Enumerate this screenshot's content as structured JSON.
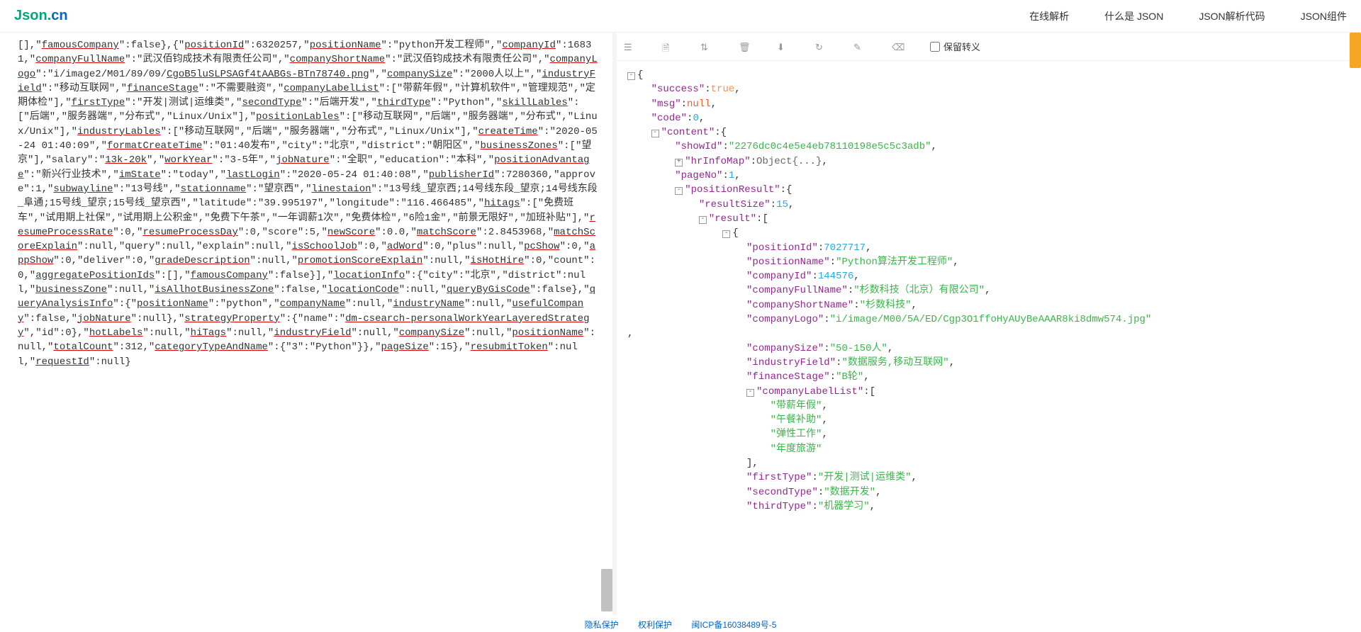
{
  "header": {
    "logo_json": "Json",
    "logo_dot": ".",
    "logo_cn": "cn",
    "nav": [
      "在线解析",
      "什么是 JSON",
      "JSON解析代码",
      "JSON组件"
    ]
  },
  "toolbar": {
    "keep_escape_label": "保留转义"
  },
  "left_raw": {
    "segments": [
      {
        "t": "[],\""
      },
      {
        "t": "famousCompany",
        "u": 1
      },
      {
        "t": "\":false},{\""
      },
      {
        "t": "positionId",
        "u": 1
      },
      {
        "t": "\":6320257,\""
      },
      {
        "t": "positionName",
        "u": 1
      },
      {
        "t": "\":\"python开发工程师\",\""
      },
      {
        "t": "companyId",
        "u": 1
      },
      {
        "t": "\":16831,\""
      },
      {
        "t": "companyFullName",
        "u": 1
      },
      {
        "t": "\":\"武汉佰钧成技术有限责任公司\",\""
      },
      {
        "t": "companyShortName",
        "u": 1
      },
      {
        "t": "\":\"武汉佰钧成技术有限责任公司\",\""
      },
      {
        "t": "companyLogo",
        "u": 1
      },
      {
        "t": "\":\"i/image2/M01/89/09/"
      },
      {
        "t": "CgoB5luSLPSAGf4tAABGs-BTn78740.png",
        "u": 1
      },
      {
        "t": "\",\""
      },
      {
        "t": "companySize",
        "u": 1
      },
      {
        "t": "\":\"2000人以上\",\""
      },
      {
        "t": "industryField",
        "u": 1
      },
      {
        "t": "\":\"移动互联网\",\""
      },
      {
        "t": "financeStage",
        "u": 1
      },
      {
        "t": "\":\"不需要融资\",\""
      },
      {
        "t": "companyLabelList",
        "u": 1
      },
      {
        "t": "\":[\"带薪年假\",\"计算机软件\",\"管理规范\",\"定期体检\"],\""
      },
      {
        "t": "firstType",
        "u": 1
      },
      {
        "t": "\":\"开发|测试|运维类\",\""
      },
      {
        "t": "secondType",
        "u": 1
      },
      {
        "t": "\":\"后端开发\",\""
      },
      {
        "t": "thirdType",
        "u": 1
      },
      {
        "t": "\":\"Python\",\""
      },
      {
        "t": "skillLables",
        "u": 1
      },
      {
        "t": "\":[\"后端\",\"服务器端\",\"分布式\",\"Linux/Unix\"],\""
      },
      {
        "t": "positionLables",
        "u": 1
      },
      {
        "t": "\":[\"移动互联网\",\"后端\",\"服务器端\",\"分布式\",\"Linux/Unix\"],\""
      },
      {
        "t": "industryLables",
        "u": 1
      },
      {
        "t": "\":[\"移动互联网\",\"后端\",\"服务器端\",\"分布式\",\"Linux/Unix\"],\""
      },
      {
        "t": "createTime",
        "u": 1
      },
      {
        "t": "\":\"2020-05-24 01:40:09\",\""
      },
      {
        "t": "formatCreateTime",
        "u": 1
      },
      {
        "t": "\":\"01:40发布\",\"city\":\"北京\",\"district\":\"朝阳区\",\""
      },
      {
        "t": "businessZones",
        "u": 1
      },
      {
        "t": "\":[\"望京\"],\"salary\":\""
      },
      {
        "t": "13k-20k",
        "u": 1
      },
      {
        "t": "\",\""
      },
      {
        "t": "workYear",
        "u": 1
      },
      {
        "t": "\":\"3-5年\",\""
      },
      {
        "t": "jobNature",
        "u": 1
      },
      {
        "t": "\":\"全职\",\"education\":\"本科\",\""
      },
      {
        "t": "positionAdvantage",
        "u": 1
      },
      {
        "t": "\":\"新兴行业技术\",\""
      },
      {
        "t": "imState",
        "u": 1
      },
      {
        "t": "\":\"today\",\""
      },
      {
        "t": "lastLogin",
        "u": 1
      },
      {
        "t": "\":\"2020-05-24 01:40:08\",\""
      },
      {
        "t": "publisherId",
        "u": 1
      },
      {
        "t": "\":7280360,\"approve\":1,\""
      },
      {
        "t": "subwayline",
        "u": 1
      },
      {
        "t": "\":\"13号线\",\""
      },
      {
        "t": "stationname",
        "u": 1
      },
      {
        "t": "\":\"望京西\",\""
      },
      {
        "t": "linestaion",
        "u": 1
      },
      {
        "t": "\":\"13号线_望京西;14号线东段_望京;14号线东段_阜通;15号线_望京;15号线_望京西\",\"latitude\":\"39.995197\",\"longitude\":\"116.466485\",\""
      },
      {
        "t": "hitags",
        "u": 1
      },
      {
        "t": "\":[\"免费班车\",\"试用期上社保\",\"试用期上公积金\",\"免费下午茶\",\"一年调薪1次\",\"免费体检\",\"6险1金\",\"前景无限好\",\"加班补贴\"],\""
      },
      {
        "t": "resumeProcessRate",
        "u": 1
      },
      {
        "t": "\":0,\""
      },
      {
        "t": "resumeProcessDay",
        "u": 1
      },
      {
        "t": "\":0,\"score\":5,\""
      },
      {
        "t": "newScore",
        "u": 1
      },
      {
        "t": "\":0.0,\""
      },
      {
        "t": "matchScore",
        "u": 1
      },
      {
        "t": "\":2.8453968,\""
      },
      {
        "t": "matchScoreExplain",
        "u": 1
      },
      {
        "t": "\":null,\"query\":null,\"explain\":null,\""
      },
      {
        "t": "isSchoolJob",
        "u": 1
      },
      {
        "t": "\":0,\""
      },
      {
        "t": "adWord",
        "u": 1
      },
      {
        "t": "\":0,\"plus\":null,\""
      },
      {
        "t": "pcShow",
        "u": 1
      },
      {
        "t": "\":0,\""
      },
      {
        "t": "appShow",
        "u": 1
      },
      {
        "t": "\":0,\"deliver\":0,\""
      },
      {
        "t": "gradeDescription",
        "u": 1
      },
      {
        "t": "\":null,\""
      },
      {
        "t": "promotionScoreExplain",
        "u": 1
      },
      {
        "t": "\":null,\""
      },
      {
        "t": "isHotHire",
        "u": 1
      },
      {
        "t": "\":0,\"count\":0,\""
      },
      {
        "t": "aggregatePositionIds",
        "u": 1
      },
      {
        "t": "\":[],\""
      },
      {
        "t": "famousCompany",
        "u": 1
      },
      {
        "t": "\":false}],\""
      },
      {
        "t": "locationInfo",
        "u": 1
      },
      {
        "t": "\":{\"city\":\"北京\",\"district\":null,\""
      },
      {
        "t": "businessZone",
        "u": 1
      },
      {
        "t": "\":null,\""
      },
      {
        "t": "isAllhotBusinessZone",
        "u": 1
      },
      {
        "t": "\":false,\""
      },
      {
        "t": "locationCode",
        "u": 1
      },
      {
        "t": "\":null,\""
      },
      {
        "t": "queryByGisCode",
        "u": 1
      },
      {
        "t": "\":false},\""
      },
      {
        "t": "queryAnalysisInfo",
        "u": 1
      },
      {
        "t": "\":{\""
      },
      {
        "t": "positionName",
        "u": 1
      },
      {
        "t": "\":\"python\",\""
      },
      {
        "t": "companyName",
        "u": 1
      },
      {
        "t": "\":null,\""
      },
      {
        "t": "industryName",
        "u": 1
      },
      {
        "t": "\":null,\""
      },
      {
        "t": "usefulCompany",
        "u": 1
      },
      {
        "t": "\":false,\""
      },
      {
        "t": "jobNature",
        "u": 1
      },
      {
        "t": "\":null},\""
      },
      {
        "t": "strategyProperty",
        "u": 1
      },
      {
        "t": "\":{\"name\":\""
      },
      {
        "t": "dm-csearch-personalWorkYearLayeredStrategy",
        "u": 1
      },
      {
        "t": "\",\"id\":0},\""
      },
      {
        "t": "hotLabels",
        "u": 1
      },
      {
        "t": "\":null,\""
      },
      {
        "t": "hiTags",
        "u": 1
      },
      {
        "t": "\":null,\""
      },
      {
        "t": "industryField",
        "u": 1
      },
      {
        "t": "\":null,\""
      },
      {
        "t": "companySize",
        "u": 1
      },
      {
        "t": "\":null,\""
      },
      {
        "t": "positionName",
        "u": 1
      },
      {
        "t": "\":null,\""
      },
      {
        "t": "totalCount",
        "u": 1
      },
      {
        "t": "\":312,\""
      },
      {
        "t": "categoryTypeAndName",
        "u": 1
      },
      {
        "t": "\":{\"3\":\"Python\"}},\""
      },
      {
        "t": "pageSize",
        "u": 1
      },
      {
        "t": "\":15},\""
      },
      {
        "t": "resubmitToken",
        "u": 1
      },
      {
        "t": "\":null,\""
      },
      {
        "t": "requestId",
        "u": 1
      },
      {
        "t": "\":null}"
      }
    ]
  },
  "right_json": {
    "lines": [
      {
        "indent": 0,
        "toggle": "⊟",
        "parts": [
          {
            "c": "p",
            "t": "{"
          }
        ]
      },
      {
        "indent": 4,
        "parts": [
          {
            "c": "k",
            "t": "\"success\""
          },
          {
            "c": "p",
            "t": ":"
          },
          {
            "c": "b",
            "t": "true"
          },
          {
            "c": "p",
            "t": ","
          }
        ]
      },
      {
        "indent": 4,
        "parts": [
          {
            "c": "k",
            "t": "\"msg\""
          },
          {
            "c": "p",
            "t": ":"
          },
          {
            "c": "nl",
            "t": "null"
          },
          {
            "c": "p",
            "t": ","
          }
        ]
      },
      {
        "indent": 4,
        "parts": [
          {
            "c": "k",
            "t": "\"code\""
          },
          {
            "c": "p",
            "t": ":"
          },
          {
            "c": "n",
            "t": "0"
          },
          {
            "c": "p",
            "t": ","
          }
        ]
      },
      {
        "indent": 4,
        "toggle": "⊟",
        "parts": [
          {
            "c": "k",
            "t": "\"content\""
          },
          {
            "c": "p",
            "t": ":{"
          }
        ]
      },
      {
        "indent": 8,
        "parts": [
          {
            "c": "k",
            "t": "\"showId\""
          },
          {
            "c": "p",
            "t": ":"
          },
          {
            "c": "s",
            "t": "\"2276dc0c4e5e4eb78110198e5c5c3adb\""
          },
          {
            "c": "p",
            "t": ","
          }
        ]
      },
      {
        "indent": 8,
        "toggle": "⊞",
        "parts": [
          {
            "c": "k",
            "t": "\"hrInfoMap\""
          },
          {
            "c": "p",
            "t": ":"
          },
          {
            "c": "collapsed-obj",
            "t": "Object{...}"
          },
          {
            "c": "p",
            "t": ","
          }
        ]
      },
      {
        "indent": 8,
        "parts": [
          {
            "c": "k",
            "t": "\"pageNo\""
          },
          {
            "c": "p",
            "t": ":"
          },
          {
            "c": "n",
            "t": "1"
          },
          {
            "c": "p",
            "t": ","
          }
        ]
      },
      {
        "indent": 8,
        "toggle": "⊟",
        "parts": [
          {
            "c": "k",
            "t": "\"positionResult\""
          },
          {
            "c": "p",
            "t": ":{"
          }
        ]
      },
      {
        "indent": 12,
        "parts": [
          {
            "c": "k",
            "t": "\"resultSize\""
          },
          {
            "c": "p",
            "t": ":"
          },
          {
            "c": "n",
            "t": "15"
          },
          {
            "c": "p",
            "t": ","
          }
        ]
      },
      {
        "indent": 12,
        "toggle": "⊟",
        "parts": [
          {
            "c": "k",
            "t": "\"result\""
          },
          {
            "c": "p",
            "t": ":["
          }
        ]
      },
      {
        "indent": 16,
        "toggle": "⊟",
        "parts": [
          {
            "c": "p",
            "t": "{"
          }
        ]
      },
      {
        "indent": 20,
        "parts": [
          {
            "c": "k",
            "t": "\"positionId\""
          },
          {
            "c": "p",
            "t": ":"
          },
          {
            "c": "n",
            "t": "7027717"
          },
          {
            "c": "p",
            "t": ","
          }
        ]
      },
      {
        "indent": 20,
        "parts": [
          {
            "c": "k",
            "t": "\"positionName\""
          },
          {
            "c": "p",
            "t": ":"
          },
          {
            "c": "s",
            "t": "\"Python算法开发工程师\""
          },
          {
            "c": "p",
            "t": ","
          }
        ]
      },
      {
        "indent": 20,
        "parts": [
          {
            "c": "k",
            "t": "\"companyId\""
          },
          {
            "c": "p",
            "t": ":"
          },
          {
            "c": "n",
            "t": "144576"
          },
          {
            "c": "p",
            "t": ","
          }
        ]
      },
      {
        "indent": 20,
        "parts": [
          {
            "c": "k",
            "t": "\"companyFullName\""
          },
          {
            "c": "p",
            "t": ":"
          },
          {
            "c": "s",
            "t": "\"杉数科技（北京）有限公司\""
          },
          {
            "c": "p",
            "t": ","
          }
        ]
      },
      {
        "indent": 20,
        "parts": [
          {
            "c": "k",
            "t": "\"companyShortName\""
          },
          {
            "c": "p",
            "t": ":"
          },
          {
            "c": "s",
            "t": "\"杉数科技\""
          },
          {
            "c": "p",
            "t": ","
          }
        ]
      },
      {
        "indent": 20,
        "parts": [
          {
            "c": "k",
            "t": "\"companyLogo\""
          },
          {
            "c": "p",
            "t": ":"
          },
          {
            "c": "s",
            "t": "\"i/image/M00/5A/ED/Cgp3O1ffoHyAUyBeAAAR8ki8dmw574.jpg\""
          }
        ]
      },
      {
        "indent": 0,
        "parts": [
          {
            "c": "p",
            "t": ","
          }
        ]
      },
      {
        "indent": 20,
        "parts": [
          {
            "c": "k",
            "t": "\"companySize\""
          },
          {
            "c": "p",
            "t": ":"
          },
          {
            "c": "s",
            "t": "\"50-150人\""
          },
          {
            "c": "p",
            "t": ","
          }
        ]
      },
      {
        "indent": 20,
        "parts": [
          {
            "c": "k",
            "t": "\"industryField\""
          },
          {
            "c": "p",
            "t": ":"
          },
          {
            "c": "s",
            "t": "\"数据服务,移动互联网\""
          },
          {
            "c": "p",
            "t": ","
          }
        ]
      },
      {
        "indent": 20,
        "parts": [
          {
            "c": "k",
            "t": "\"financeStage\""
          },
          {
            "c": "p",
            "t": ":"
          },
          {
            "c": "s",
            "t": "\"B轮\""
          },
          {
            "c": "p",
            "t": ","
          }
        ]
      },
      {
        "indent": 20,
        "toggle": "⊟",
        "parts": [
          {
            "c": "k",
            "t": "\"companyLabelList\""
          },
          {
            "c": "p",
            "t": ":["
          }
        ]
      },
      {
        "indent": 24,
        "parts": [
          {
            "c": "s",
            "t": "\"带薪年假\""
          },
          {
            "c": "p",
            "t": ","
          }
        ]
      },
      {
        "indent": 24,
        "parts": [
          {
            "c": "s",
            "t": "\"午餐补助\""
          },
          {
            "c": "p",
            "t": ","
          }
        ]
      },
      {
        "indent": 24,
        "parts": [
          {
            "c": "s",
            "t": "\"弹性工作\""
          },
          {
            "c": "p",
            "t": ","
          }
        ]
      },
      {
        "indent": 24,
        "parts": [
          {
            "c": "s",
            "t": "\"年度旅游\""
          }
        ]
      },
      {
        "indent": 20,
        "parts": [
          {
            "c": "p",
            "t": "],"
          }
        ]
      },
      {
        "indent": 20,
        "parts": [
          {
            "c": "k",
            "t": "\"firstType\""
          },
          {
            "c": "p",
            "t": ":"
          },
          {
            "c": "s",
            "t": "\"开发|测试|运维类\""
          },
          {
            "c": "p",
            "t": ","
          }
        ]
      },
      {
        "indent": 20,
        "parts": [
          {
            "c": "k",
            "t": "\"secondType\""
          },
          {
            "c": "p",
            "t": ":"
          },
          {
            "c": "s",
            "t": "\"数据开发\""
          },
          {
            "c": "p",
            "t": ","
          }
        ]
      },
      {
        "indent": 20,
        "parts": [
          {
            "c": "k",
            "t": "\"thirdType\""
          },
          {
            "c": "p",
            "t": ":"
          },
          {
            "c": "s",
            "t": "\"机器学习\""
          },
          {
            "c": "p",
            "t": ","
          }
        ]
      }
    ]
  },
  "footer": {
    "privacy": "隐私保护",
    "rights": "权利保护",
    "icp": "闽ICP备16038489号-5"
  },
  "chart_data": null
}
